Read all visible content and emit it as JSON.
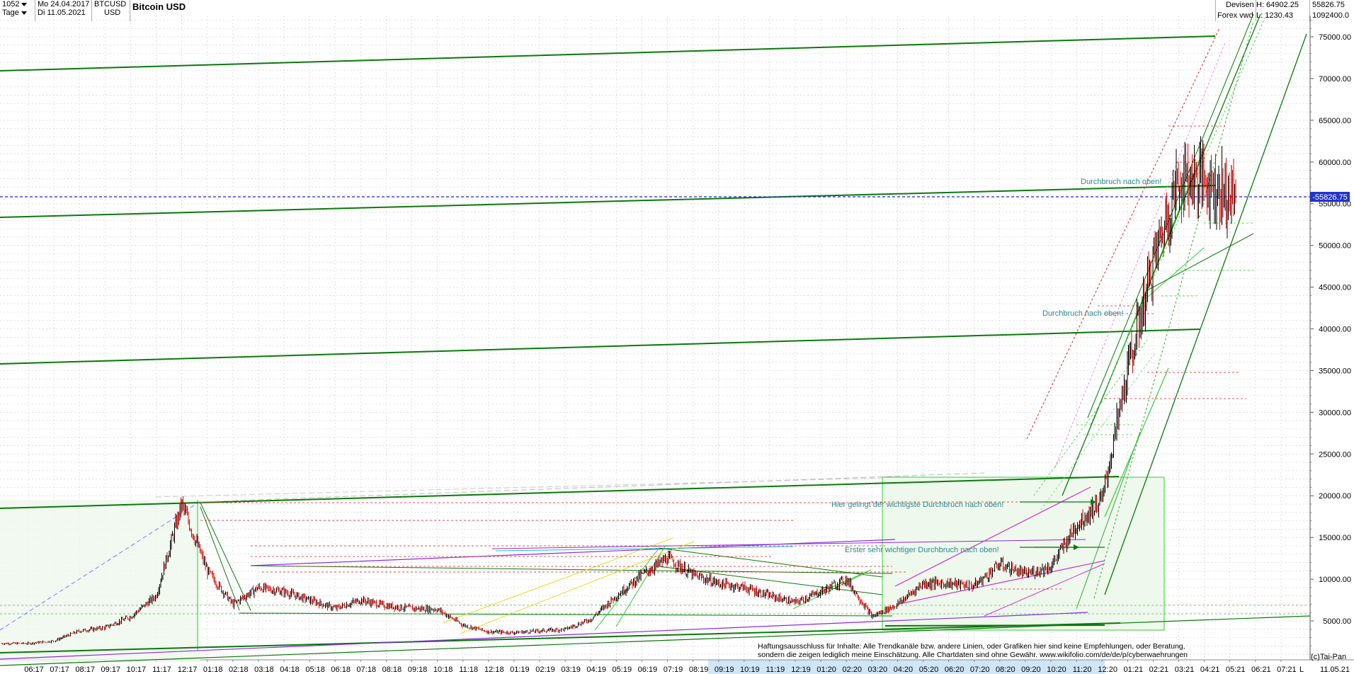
{
  "header": {
    "bar_count": "1052",
    "interval": "Tage",
    "date_from": "Mo 24.04.2017",
    "date_to": "Di 11.05.2021",
    "symbol": "BTCUSD",
    "currency": "USD",
    "title": "Bitcoin USD",
    "category": "Devisen",
    "source": "Forex vwd",
    "high_label": "H: 64902.25",
    "low_label": "L: 1230.43",
    "last_price": "55826.75",
    "volume": "1092400.0"
  },
  "chart_data": {
    "type": "line",
    "title": "Bitcoin USD",
    "subtype": "candlestick",
    "ylim": [
      0,
      80000
    ],
    "y_ticks": [
      "5000.00",
      "10000.00",
      "15000.00",
      "20000.00",
      "25000.00",
      "30000.00",
      "35000.00",
      "40000.00",
      "45000.00",
      "50000.00",
      "55000.00",
      "60000.00",
      "65000.00",
      "70000.00",
      "75000.00"
    ],
    "current_price_label": "55826.75",
    "current_price": 55826.75,
    "grid": true,
    "x_labels": [
      "06:17",
      "07:17",
      "08:17",
      "09:17",
      "10:17",
      "11:17",
      "12:17",
      "01:18",
      "02:18",
      "03:18",
      "04:18",
      "05:18",
      "06:18",
      "07:18",
      "08:18",
      "09:18",
      "10:18",
      "11:18",
      "12:18",
      "01:19",
      "02:19",
      "03:19",
      "04:19",
      "05:19",
      "06:19",
      "07:19",
      "08:19",
      "09:19",
      "10:19",
      "11:19",
      "12:19",
      "01:20",
      "02:20",
      "03:20",
      "04:20",
      "05:20",
      "06:20",
      "07:20",
      "08:20",
      "09:20",
      "10:20",
      "11:20",
      "12:20",
      "01:21",
      "02:21",
      "03:21",
      "04:21",
      "05:21",
      "06:21",
      "07:21"
    ],
    "x_axis_end_label": "11.05.21",
    "x_axis_letter": "L",
    "series": [
      {
        "values": [
          [
            "06:17",
            2300
          ],
          [
            "07:17",
            2600
          ],
          [
            "08:17",
            3800
          ],
          [
            "09:17",
            4200
          ],
          [
            "10:17",
            5500
          ],
          [
            "11:17",
            8000
          ],
          [
            "12:17",
            19000
          ],
          [
            "01:18",
            11000
          ],
          [
            "02:18",
            7000
          ],
          [
            "03:18",
            9000
          ],
          [
            "04:18",
            8500
          ],
          [
            "05:18",
            7500
          ],
          [
            "06:18",
            6500
          ],
          [
            "07:18",
            7500
          ],
          [
            "08:18",
            6800
          ],
          [
            "09:18",
            6500
          ],
          [
            "10:18",
            6400
          ],
          [
            "11:18",
            4500
          ],
          [
            "12:18",
            3700
          ],
          [
            "01:19",
            3600
          ],
          [
            "02:19",
            3800
          ],
          [
            "03:19",
            4000
          ],
          [
            "04:19",
            5200
          ],
          [
            "05:19",
            8000
          ],
          [
            "06:19",
            10500
          ],
          [
            "07:19",
            12500
          ],
          [
            "08:19",
            10500
          ],
          [
            "09:19",
            9500
          ],
          [
            "10:19",
            9000
          ],
          [
            "11:19",
            8000
          ],
          [
            "12:19",
            7200
          ],
          [
            "01:20",
            8500
          ],
          [
            "02:20",
            10000
          ],
          [
            "03:20",
            5500
          ],
          [
            "04:20",
            7000
          ],
          [
            "05:20",
            9500
          ],
          [
            "06:20",
            9500
          ],
          [
            "07:20",
            9200
          ],
          [
            "08:20",
            11800
          ],
          [
            "09:20",
            10600
          ],
          [
            "10:20",
            11500
          ],
          [
            "11:20",
            16500
          ],
          [
            "12:20",
            19500
          ],
          [
            "01:21",
            35000
          ],
          [
            "02:21",
            48000
          ],
          [
            "03:21",
            58000
          ],
          [
            "04:21",
            58000
          ],
          [
            "05:21",
            55826.75
          ]
        ]
      }
    ],
    "annotations": [
      "Durchbruch nach oben!",
      "Durchbruch nach oben!",
      "Hier gelingt der wichtigste Durchbruch nach oben!",
      "Erster sehr wichtiger Durchbruch nach oben!"
    ]
  },
  "disclaimer": {
    "line1": "Haftungsausschluss für Inhalte: Alle Trendkanäle bzw. andere Linien, oder Grafiken hier sind keine Empfehlungen, oder Beratung,",
    "line2": "sondern die zeigen lediglich meine  Einschätzung. Alle Chartdaten sind ohne Gewähr.  www.wikifolio.com/de/de/p/cyberwaehrungen"
  },
  "copyright": "(c)Tai-Pan",
  "colors": {
    "up": "#000000",
    "down": "#e00000",
    "trend": "#228b22",
    "price_line": "#2020e0",
    "annotation": "#2a8a8a"
  }
}
